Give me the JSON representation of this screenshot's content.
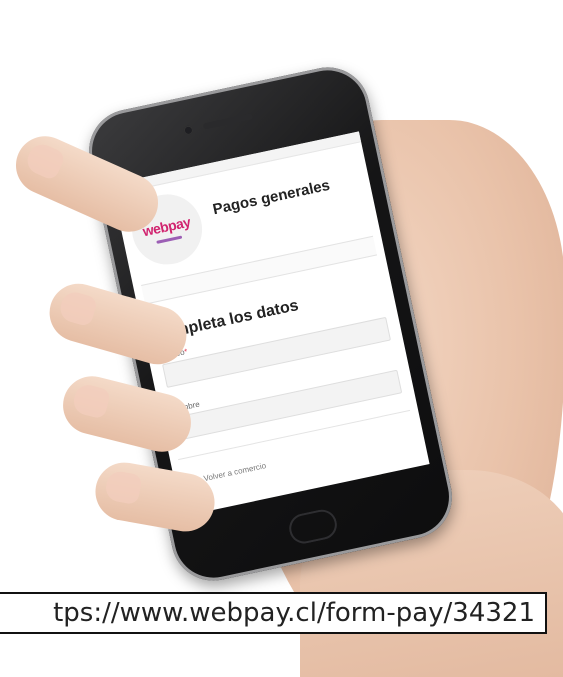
{
  "screen": {
    "logo_text": "webpay",
    "page_title": "Pagos generales",
    "form_title": "Completa los datos",
    "fields": [
      {
        "label": "Correo",
        "required_mark": "*",
        "value": ""
      },
      {
        "label": "Nombre",
        "required_mark": "",
        "value": ""
      }
    ],
    "back_link": "Volver a comercio"
  },
  "caption": {
    "url": "tps://www.webpay.cl/form-pay/34321"
  },
  "colors": {
    "brand": "#d1246f",
    "brand_secondary": "#9c5fb5",
    "required": "#e0334f"
  },
  "icons": {
    "back": "back-arrow-icon"
  }
}
